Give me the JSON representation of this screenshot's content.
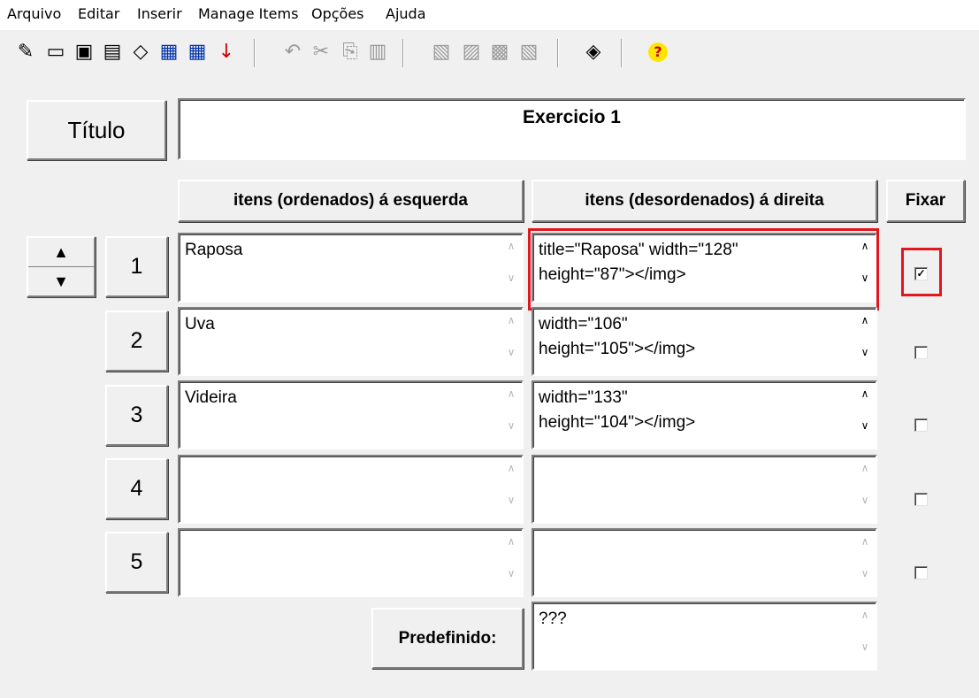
{
  "menu": [
    "Arquivo",
    "Editar",
    "Inserir",
    "Manage Items",
    "Opções",
    "Ajuda"
  ],
  "toolbar_icons": [
    "new-icon",
    "open-folder-icon",
    "save-icon",
    "save-as-icon",
    "eraser-icon",
    "web-export-icon",
    "web-export-alt-icon",
    "down-arrow-icon",
    "undo-icon",
    "cut-icon",
    "copy-icon",
    "paste-icon",
    "tool-1-icon",
    "tool-2-icon",
    "tool-3-icon",
    "tool-4-icon",
    "palette-icon",
    "help-icon"
  ],
  "titulo": {
    "label": "Título",
    "value": "Exercicio 1"
  },
  "headers": {
    "left": "itens (ordenados) á esquerda",
    "right": "itens (desordenados) á direita",
    "fix": "Fixar"
  },
  "rows": [
    {
      "num": "1",
      "left": "Raposa",
      "right": "title=\"Raposa\" width=\"128\"\nheight=\"87\"></img>",
      "fixed": true
    },
    {
      "num": "2",
      "left": "Uva",
      "right": "width=\"106\"\nheight=\"105\"></img>",
      "fixed": false
    },
    {
      "num": "3",
      "left": "Videira",
      "right": "width=\"133\"\nheight=\"104\"></img>",
      "fixed": false
    },
    {
      "num": "4",
      "left": "",
      "right": "",
      "fixed": false
    },
    {
      "num": "5",
      "left": "",
      "right": "",
      "fixed": false
    }
  ],
  "predefinido": {
    "label": "Predefinido:",
    "value": "???"
  },
  "highlight_color": "#e0171f"
}
